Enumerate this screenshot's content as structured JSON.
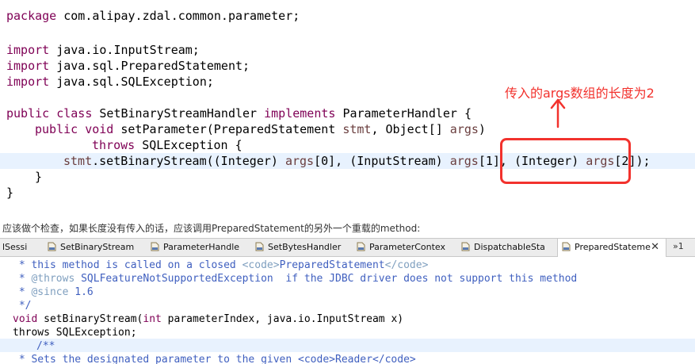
{
  "code": {
    "package_kw": "package",
    "package_name": " com.alipay.zdal.common.parameter;",
    "import_kw": "import",
    "import1": " java.io.InputStream;",
    "import2": " java.sql.PreparedStatement;",
    "import3": " java.sql.SQLException;",
    "cls_public": "public",
    "cls_class": "class",
    "cls_name": " SetBinaryStreamHandler ",
    "cls_implements": "implements",
    "cls_iface": " ParameterHandler {",
    "m_public": "public",
    "m_void": "void",
    "m_sig": " setParameter(PreparedStatement ",
    "m_stmt": "stmt",
    "m_obj": ", Object[] ",
    "m_args": "args",
    "m_close": ")",
    "throws_kw": "throws",
    "throws_rest": " SQLException {",
    "call_stmt": "stmt",
    "call_a": ".setBinaryStream((Integer) ",
    "args": "args",
    "idx0": "[0], (InputStream) ",
    "idx1": "[1], (Integer) ",
    "idx2": "[2]);",
    "brace_inner": "}",
    "brace_outer": "}"
  },
  "annotation": {
    "text": "传入的args数组的长度为2"
  },
  "note": {
    "text": "应该做个检查，如果长度没有传入的话，应该调用PreparedStatement的另外一个重载的method:"
  },
  "tabs": [
    {
      "label": "lSessi"
    },
    {
      "label": "SetBinaryStream"
    },
    {
      "label": "ParameterHandle"
    },
    {
      "label": "SetBytesHandler"
    },
    {
      "label": "ParameterContex"
    },
    {
      "label": "DispatchableSta"
    },
    {
      "label": "PreparedStateme"
    }
  ],
  "tab_close": "✕",
  "tab_overflow": "»1",
  "code2": {
    "l1_star": " * this method is called on a closed ",
    "l1_code_open": "<code>",
    "l1_name": "PreparedStatement",
    "l1_code_close": "</code>",
    "l2_star": " * ",
    "l2_tag": "@throws",
    "l2_rest": " SQLFeatureNotSupportedException  if the JDBC driver does not support this method",
    "l3_star": " * ",
    "l3_tag": "@since",
    "l3_rest": " 1.6",
    "l4": " */",
    "l5_void": "void",
    "l5_rest": " setBinaryStream(",
    "l5_int": "int",
    "l5_rest2": " parameterIndex, java.io.InputStream x)",
    "l6": "throws SQLException;",
    "l7": "/**",
    "l8": " * Sets the designated parameter to the given <code>Reader</code>"
  }
}
